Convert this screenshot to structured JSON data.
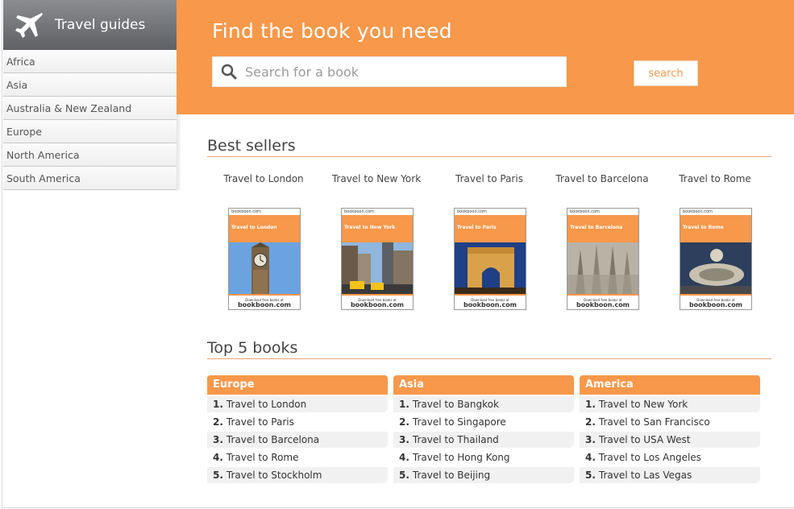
{
  "sidebar": {
    "title": "Travel guides",
    "items": [
      {
        "label": "Africa"
      },
      {
        "label": "Asia"
      },
      {
        "label": "Australia & New Zealand"
      },
      {
        "label": "Europe"
      },
      {
        "label": "North America"
      },
      {
        "label": "South America"
      }
    ]
  },
  "hero": {
    "title": "Find the book you need",
    "search_placeholder": "Search for a book",
    "search_button": "search"
  },
  "best_sellers": {
    "title": "Best sellers",
    "books": [
      {
        "title": "Travel to London",
        "cover_title": "Travel to London"
      },
      {
        "title": "Travel to New York",
        "cover_title": "Travel to New York"
      },
      {
        "title": "Travel to Paris",
        "cover_title": "Travel to Paris"
      },
      {
        "title": "Travel to Barcelona",
        "cover_title": "Travel to Barcelona"
      },
      {
        "title": "Travel to Rome",
        "cover_title": "Travel to Rome"
      }
    ],
    "cover_brand": "bookboon.com",
    "cover_footer_small": "Download free books at",
    "cover_footer_brand": "bookboon.com"
  },
  "top5": {
    "title": "Top 5 books",
    "columns": [
      {
        "region": "Europe",
        "items": [
          {
            "num": "1.",
            "label": "Travel to London"
          },
          {
            "num": "2.",
            "label": "Travel to Paris"
          },
          {
            "num": "3.",
            "label": "Travel to Barcelona"
          },
          {
            "num": "4.",
            "label": "Travel to Rome"
          },
          {
            "num": "5.",
            "label": "Travel to Stockholm"
          }
        ]
      },
      {
        "region": "Asia",
        "items": [
          {
            "num": "1.",
            "label": "Travel to Bangkok"
          },
          {
            "num": "2.",
            "label": "Travel to Singapore"
          },
          {
            "num": "3.",
            "label": "Travel to Thailand"
          },
          {
            "num": "4.",
            "label": "Travel to Hong Kong"
          },
          {
            "num": "5.",
            "label": "Travel to Beijing"
          }
        ]
      },
      {
        "region": "America",
        "items": [
          {
            "num": "1.",
            "label": "Travel to New York"
          },
          {
            "num": "2.",
            "label": "Travel to San Francisco"
          },
          {
            "num": "3.",
            "label": "Travel to USA West"
          },
          {
            "num": "4.",
            "label": "Travel to Los Angeles"
          },
          {
            "num": "5.",
            "label": "Travel to Las Vegas"
          }
        ]
      }
    ]
  },
  "colors": {
    "accent": "#f7984a",
    "sidebar_header": "#6c6e71"
  }
}
